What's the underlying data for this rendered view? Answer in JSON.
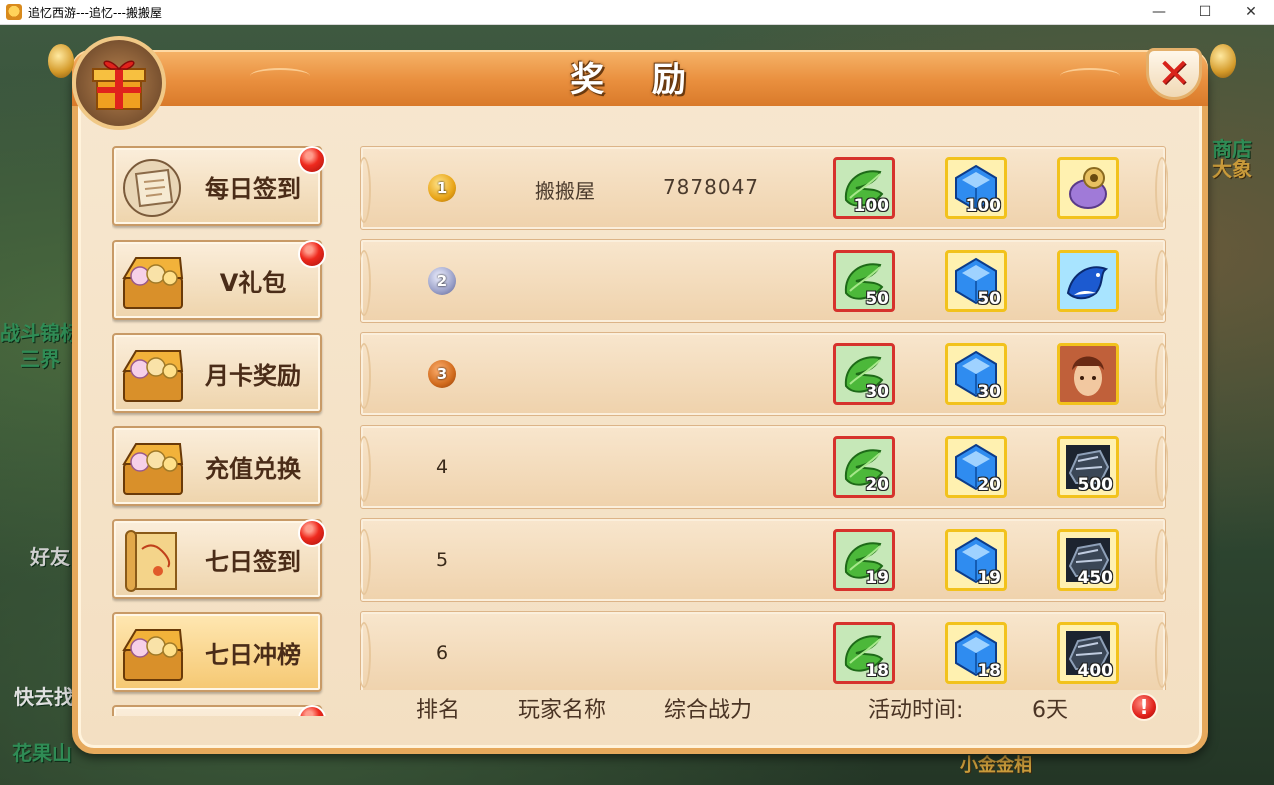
{
  "window": {
    "title": "追忆西游---追忆---搬搬屋",
    "controls": {
      "minimize": "—",
      "maximize": "☐",
      "close": "✕"
    }
  },
  "background": {
    "texts": [
      "战斗锦标",
      "三界",
      "好友",
      "快去找",
      "花果山",
      "大象",
      "商店",
      "小金金相"
    ]
  },
  "dialog": {
    "title": "奖 励",
    "close_label": "✕"
  },
  "sidebar": {
    "items": [
      {
        "label": "每日签到",
        "icon": "scroll-icon",
        "badge": true,
        "active": false
      },
      {
        "label": "V礼包",
        "icon": "treasure-chest-icon",
        "badge": true,
        "active": false
      },
      {
        "label": "月卡奖励",
        "icon": "treasure-chest-icon",
        "badge": false,
        "active": false
      },
      {
        "label": "充值兑换",
        "icon": "treasure-chest-icon",
        "badge": false,
        "active": false
      },
      {
        "label": "七日签到",
        "icon": "map-scroll-icon",
        "badge": true,
        "active": false
      },
      {
        "label": "七日冲榜",
        "icon": "treasure-chest-icon",
        "badge": false,
        "active": true
      },
      {
        "label": "",
        "icon": "treasure-chest-icon",
        "badge": true,
        "active": false
      }
    ]
  },
  "rankings": [
    {
      "rank": "1",
      "medal": "gold",
      "name": "搬搬屋",
      "power": "7878047",
      "rewards": [
        {
          "type": "leaf",
          "count": "100"
        },
        {
          "type": "gem",
          "count": "100"
        },
        {
          "type": "pet-purple",
          "count": ""
        }
      ]
    },
    {
      "rank": "2",
      "medal": "silver",
      "name": "",
      "power": "",
      "rewards": [
        {
          "type": "leaf",
          "count": "50"
        },
        {
          "type": "gem",
          "count": "50"
        },
        {
          "type": "pet-dolphin",
          "count": ""
        }
      ]
    },
    {
      "rank": "3",
      "medal": "bronze",
      "name": "",
      "power": "",
      "rewards": [
        {
          "type": "leaf",
          "count": "30"
        },
        {
          "type": "gem",
          "count": "30"
        },
        {
          "type": "hero-portrait",
          "count": ""
        }
      ]
    },
    {
      "rank": "4",
      "medal": "",
      "name": "",
      "power": "",
      "rewards": [
        {
          "type": "leaf",
          "count": "20"
        },
        {
          "type": "gem",
          "count": "20"
        },
        {
          "type": "iron-ore",
          "count": "500"
        }
      ]
    },
    {
      "rank": "5",
      "medal": "",
      "name": "",
      "power": "",
      "rewards": [
        {
          "type": "leaf",
          "count": "19"
        },
        {
          "type": "gem",
          "count": "19"
        },
        {
          "type": "iron-ore",
          "count": "450"
        }
      ]
    },
    {
      "rank": "6",
      "medal": "",
      "name": "",
      "power": "",
      "rewards": [
        {
          "type": "leaf",
          "count": "18"
        },
        {
          "type": "gem",
          "count": "18"
        },
        {
          "type": "iron-ore",
          "count": "400"
        }
      ]
    }
  ],
  "footer": {
    "rank_header": "排名",
    "name_header": "玩家名称",
    "power_header": "综合战力",
    "time_label": "活动时间:",
    "time_value": "6天",
    "info_icon": "!"
  },
  "colors": {
    "accent_orange": "#e98f3e",
    "panel_bg": "#f3dfc2",
    "badge_red": "#ef2a1e",
    "item_red_border": "#d6322c",
    "item_gold_border": "#f2c21c"
  }
}
